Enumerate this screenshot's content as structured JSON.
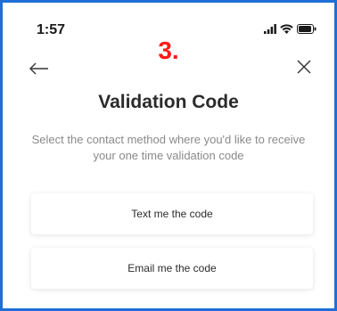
{
  "status_bar": {
    "time": "1:57",
    "icons": [
      "signal-icon",
      "wifi-icon",
      "battery-icon"
    ]
  },
  "step_label": "3.",
  "colors": {
    "frame": "#1f6fd6",
    "step_label": "#ff1a1a",
    "title": "#2b2b2b",
    "subtitle": "#8a8a8a"
  },
  "header": {
    "back_icon": "back-arrow-icon",
    "close_icon": "close-icon"
  },
  "main": {
    "title": "Validation Code",
    "subtitle": "Select the contact method where you'd like to receive your one time validation code",
    "options": [
      {
        "label": "Text me the code"
      },
      {
        "label": "Email me the code"
      }
    ]
  }
}
